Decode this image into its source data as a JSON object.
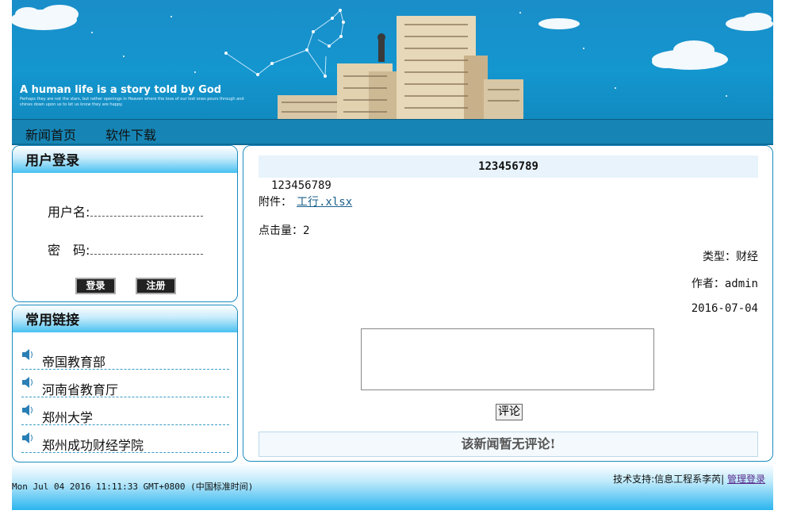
{
  "banner": {
    "tagline": "A human life is a story told by God",
    "subline": "Perhaps they are not the stars, but rather openings in Heaven where the love of our lost ones pours through and shines down upon us to let us know they are happy."
  },
  "nav": {
    "items": [
      "新闻首页",
      "软件下载"
    ]
  },
  "login": {
    "title": "用户登录",
    "username_label": "用户名:",
    "password_label": "密　码:",
    "login_button": "登录",
    "register_button": "注册"
  },
  "links": {
    "title": "常用链接",
    "items": [
      "帝国教育部",
      "河南省教育厅",
      "郑州大学",
      "郑州成功财经学院"
    ]
  },
  "article": {
    "title": "123456789",
    "body": "123456789",
    "attachment_label": "附件：",
    "attachment_file": "工行.xlsx",
    "clicks": "点击量：2",
    "type": "类型：财经",
    "author": "作者：admin",
    "date": "2016-07-04",
    "comment_button": "评论",
    "no_comment": "该新闻暂无评论!"
  },
  "footer": {
    "clock": "Mon Jul 04 2016 11:11:33 GMT+0800 (中国标准时间)",
    "support": "技术支持:信息工程系李芮|",
    "admin_link": "管理登录"
  },
  "colors": {
    "banner_blue": "#1496cf",
    "nav_blue": "#1685b5",
    "box_border": "#1b8bc0"
  }
}
